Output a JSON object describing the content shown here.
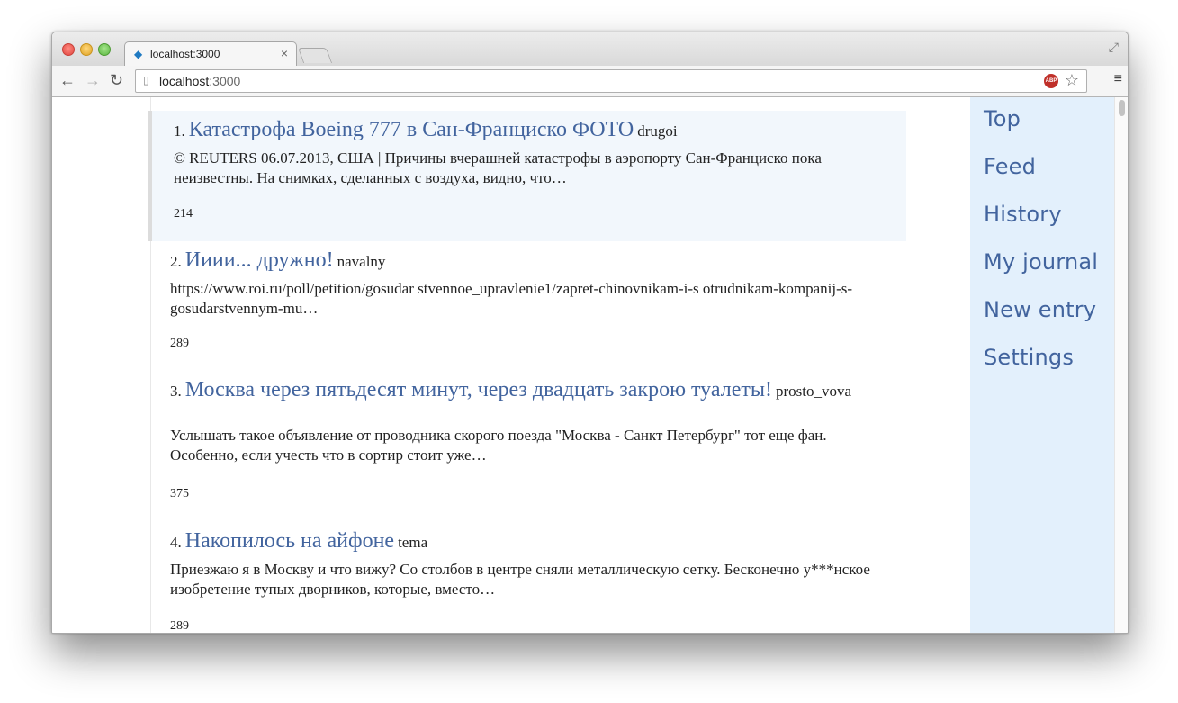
{
  "browser": {
    "tab_title": "localhost:3000",
    "url_host": "localhost",
    "url_port": ":3000",
    "abp_label": "ABP"
  },
  "entries": [
    {
      "number": "1.",
      "title": "Катастрофа Boeing 777 в Сан-Франциско ФОТО",
      "author": "drugoi",
      "excerpt": "© REUTERS 06.07.2013, США | Причины вчерашней катастрофы в аэропорту Сан-Франциско пока неизвестны. На снимках, сделанных с воздуха, видно, что…",
      "count": "214"
    },
    {
      "number": "2.",
      "title": "Ииии... дружно!",
      "author": "navalny",
      "excerpt": "https://www.roi.ru/poll/petition/gosudar stvennoe_upravlenie1/zapret-chinovnikam-i-s otrudnikam-kompanij-s-gosudarstvennym-mu…",
      "count": "289"
    },
    {
      "number": "3.",
      "title": "Москва через пятьдесят минут, через двадцать закрою туалеты!",
      "author": "prosto_vova",
      "excerpt": "Услышать такое объявление от проводника скорого поезда \"Москва - Санкт Петербург\" тот еще фан. Особенно, если учесть что в сортир стоит уже…",
      "count": "375"
    },
    {
      "number": "4.",
      "title": "Накопилось на айфоне",
      "author": "tema",
      "excerpt": "Приезжаю я в Москву и что вижу? Со столбов в центре сняли металлическую сетку. Бесконечно у***нское изобретение тупых дворников, которые, вместо…",
      "count": "289"
    }
  ],
  "sidebar": {
    "items": [
      "Top",
      "Feed",
      "History",
      "My journal",
      "New entry",
      "Settings"
    ]
  },
  "colors": {
    "link": "#42649e",
    "sidebar_bg": "#e3f0fc",
    "highlight_bg": "#f2f7fc"
  }
}
